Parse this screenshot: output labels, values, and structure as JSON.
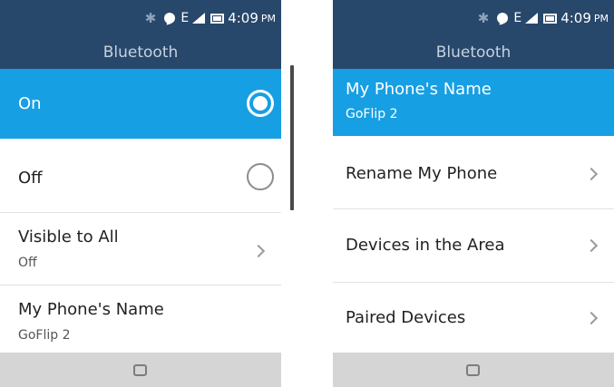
{
  "status_bar": {
    "network_type": "E",
    "time": "4:09",
    "ampm": "PM"
  },
  "left_screen": {
    "title": "Bluetooth",
    "items": [
      {
        "label": "On"
      },
      {
        "label": "Off"
      },
      {
        "label": "Visible to All",
        "value": "Off"
      },
      {
        "label": "My Phone's Name",
        "value": "GoFlip 2"
      }
    ],
    "selected_option": "On"
  },
  "right_screen": {
    "title": "Bluetooth",
    "items": [
      {
        "label": "My Phone's Name",
        "value": "GoFlip 2"
      },
      {
        "label": "Rename My Phone"
      },
      {
        "label": "Devices in the Area"
      },
      {
        "label": "Paired Devices"
      }
    ]
  },
  "colors": {
    "header": "#27476b",
    "selected": "#179fe3",
    "nav_bar": "#d5d5d5"
  },
  "icons": [
    "bluetooth-icon",
    "message-icon",
    "signal-icon",
    "battery-icon",
    "radio-icon",
    "chevron-right-icon",
    "home-icon"
  ]
}
